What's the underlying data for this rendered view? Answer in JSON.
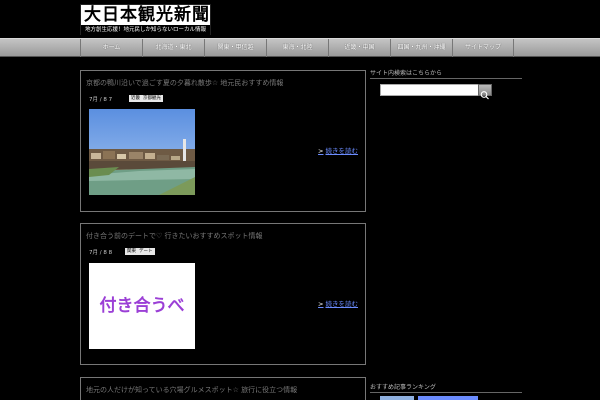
{
  "header": {
    "logo_title": "大日本観光新聞",
    "logo_sub": "地方創生応援！地元民しか知らないローカル情報"
  },
  "nav": {
    "items": [
      "ホーム",
      "北海道・東北",
      "関東・甲信越",
      "東海・北陸",
      "近畿・中国",
      "四国・九州・沖縄",
      "サイトマップ"
    ]
  },
  "posts": [
    {
      "title": "京都の鴨川沿いで過ごす夏の夕暮れ散歩☆ 地元民おすすめ情報",
      "date": "7月 / 8 7",
      "tags": [
        "近畿",
        "京都観光"
      ],
      "more": "続きを読む"
    },
    {
      "title": "付き合う前のデートで♡ 行きたいおすすめスポット情報",
      "date": "7月 / 8 8",
      "tags": [
        "関東",
        "デート"
      ],
      "thumb_text": "付き合うべ",
      "more": "続きを読む"
    },
    {
      "title": "地元の人だけが知っている穴場グルメスポット☆ 旅行に役立つ情報"
    }
  ],
  "sidebar": {
    "title": "サイト内検索はこちらから",
    "search_placeholder": "",
    "recent_title": "おすすめ記事ランキング"
  },
  "colors": {
    "background": "#000000",
    "nav": "#b0b0b0",
    "link": "#6b8cff",
    "thumb2_text": "#9b3fd6"
  }
}
